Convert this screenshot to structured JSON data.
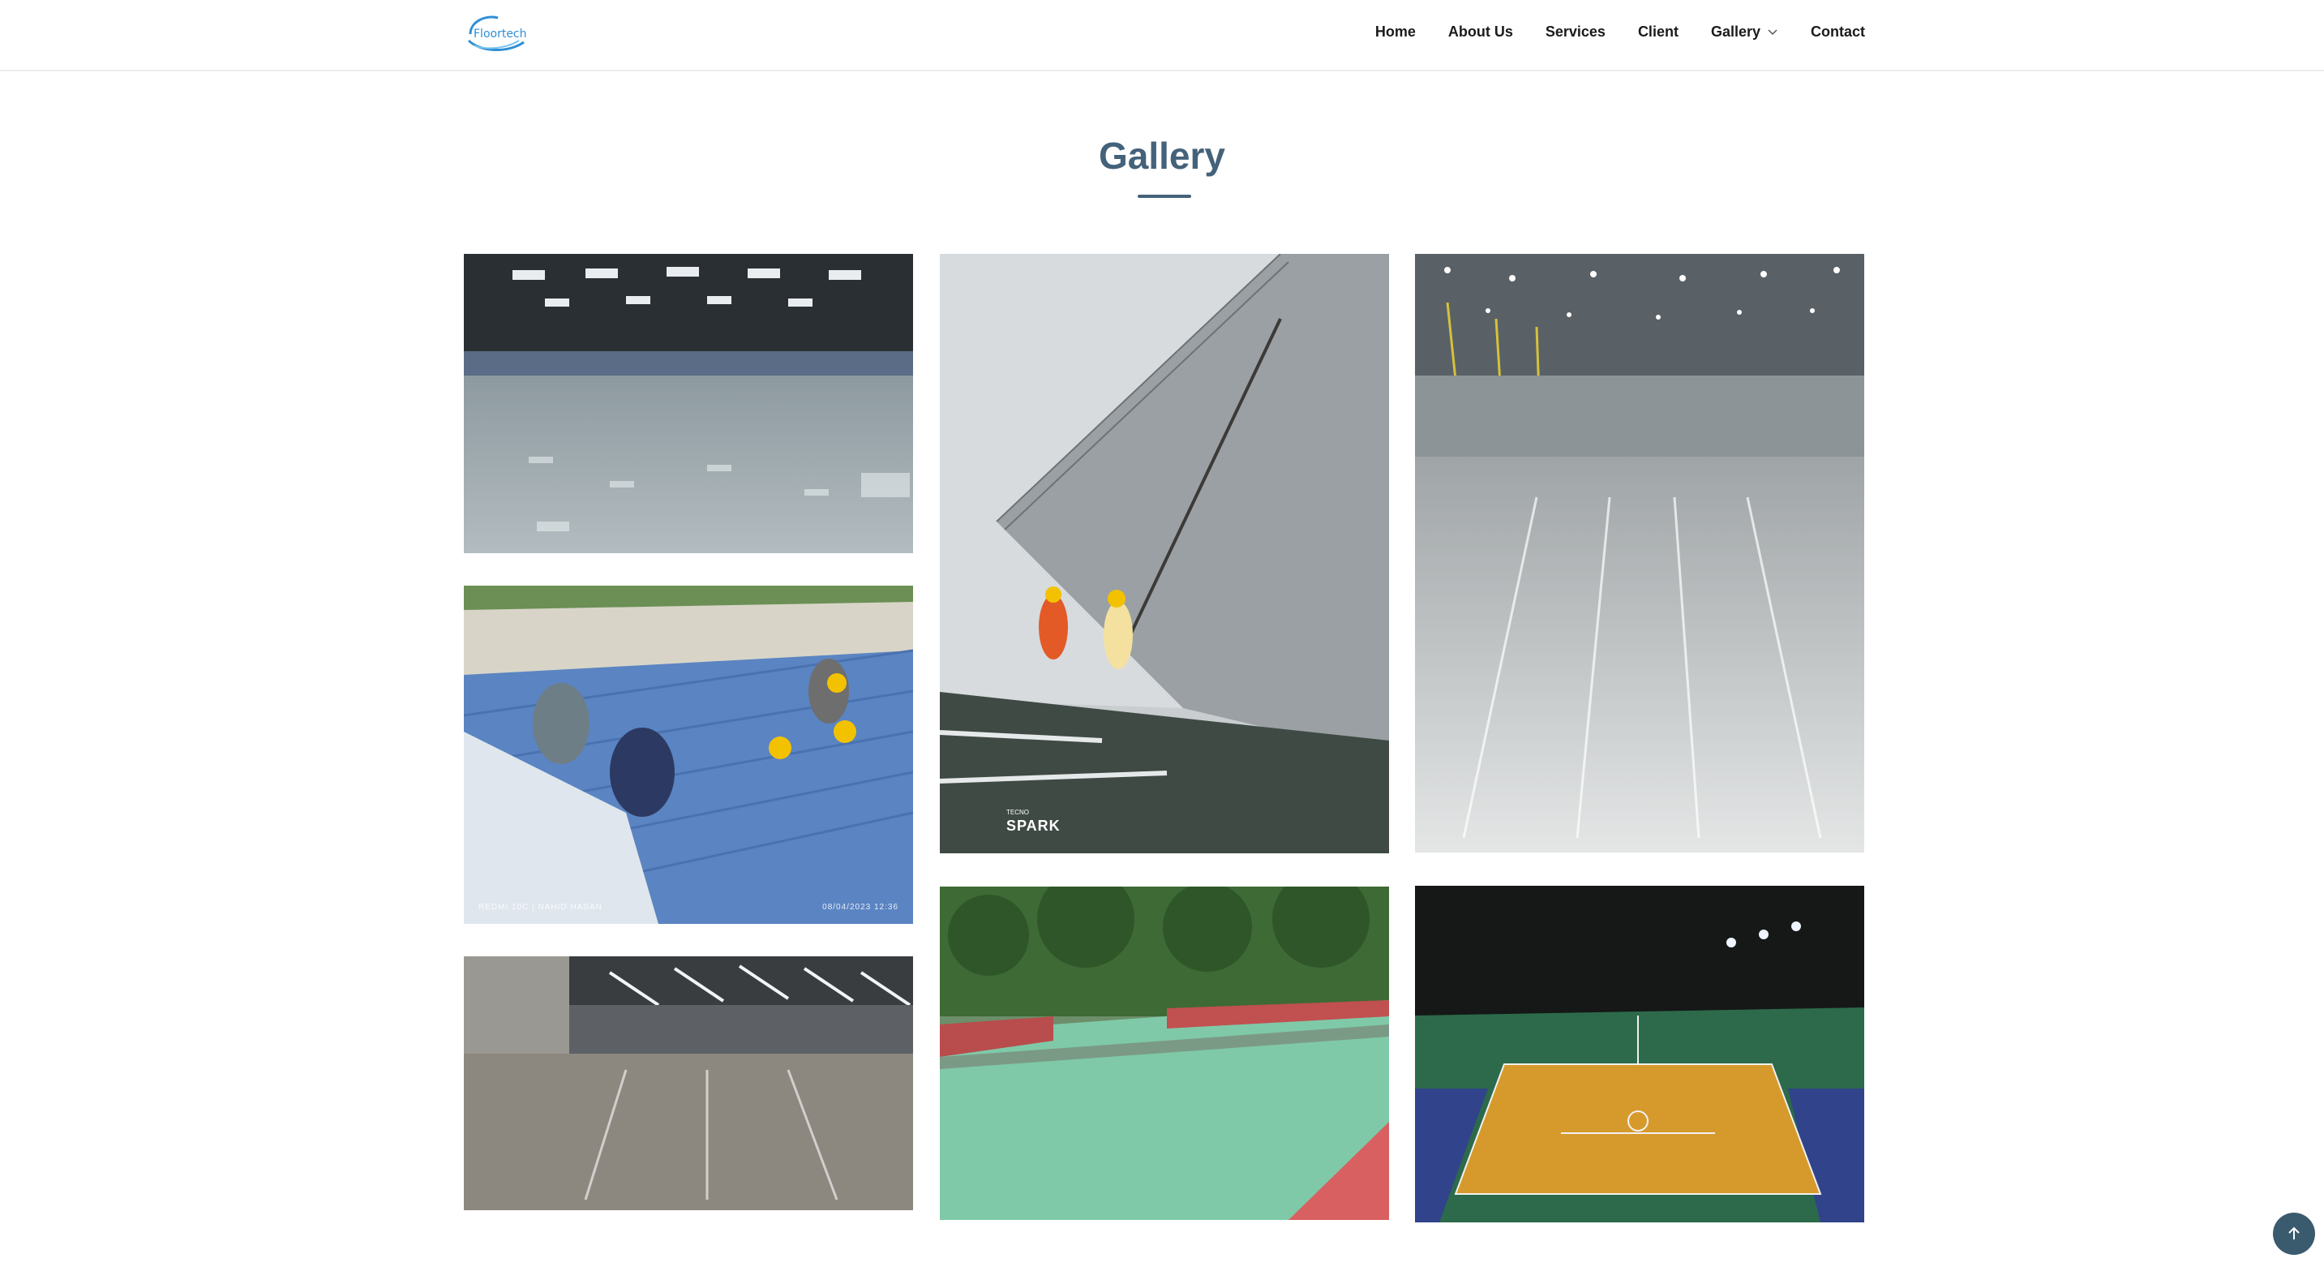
{
  "header": {
    "logo_text": "Floortech",
    "nav": [
      {
        "label": "Home"
      },
      {
        "label": "About Us"
      },
      {
        "label": "Services"
      },
      {
        "label": "Client"
      },
      {
        "label": "Gallery"
      },
      {
        "label": "Contact"
      }
    ]
  },
  "gallery": {
    "title": "Gallery",
    "photo_captions": {
      "roof_left": "REDMI 10C | NAHID HASAN",
      "roof_right": "08/04/2023 12:36",
      "tank_brand": "SPARK",
      "tank_brand_small": "TECNO"
    }
  },
  "colors": {
    "accent": "#44627a",
    "back_to_top": "#3a5a6e"
  },
  "icons": {
    "dropdown": "chevron-down-icon",
    "back_to_top": "arrow-up-icon"
  }
}
